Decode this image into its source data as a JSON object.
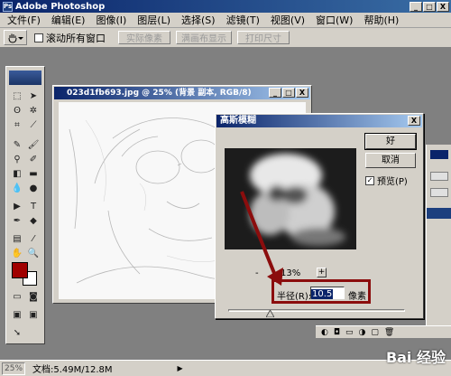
{
  "app": {
    "title": "Adobe Photoshop",
    "logo_text": "Ps"
  },
  "window_buttons": {
    "minimize": "_",
    "maximize": "□",
    "close": "X"
  },
  "menu": [
    "文件(F)",
    "编辑(E)",
    "图像(I)",
    "图层(L)",
    "选择(S)",
    "滤镜(T)",
    "视图(V)",
    "窗口(W)",
    "帮助(H)"
  ],
  "options_bar": {
    "resize_windows_label": "滚动所有窗口",
    "actual_pixels": "实际像素",
    "fit_on_screen": "满画布显示",
    "print_size": "打印尺寸"
  },
  "document": {
    "title": "023d1fb693.jpg @ 25% (背景 副本, RGB/8)"
  },
  "dialog": {
    "title": "高斯模糊",
    "ok": "好",
    "cancel": "取消",
    "preview_label": "预览(P)",
    "zoom_minus": "-",
    "zoom_level": "13%",
    "zoom_plus": "+",
    "radius_label": "半径(R):",
    "radius_value": "10.5",
    "radius_unit": "像素"
  },
  "status": {
    "zoom": "25%",
    "doc_info": "文档:5.49M/12.8M",
    "arrow": "▶"
  },
  "watermark": "Bai 经验",
  "colors": {
    "foreground": "#a00000",
    "background": "#ffffff",
    "highlight": "#8b0d0d"
  }
}
